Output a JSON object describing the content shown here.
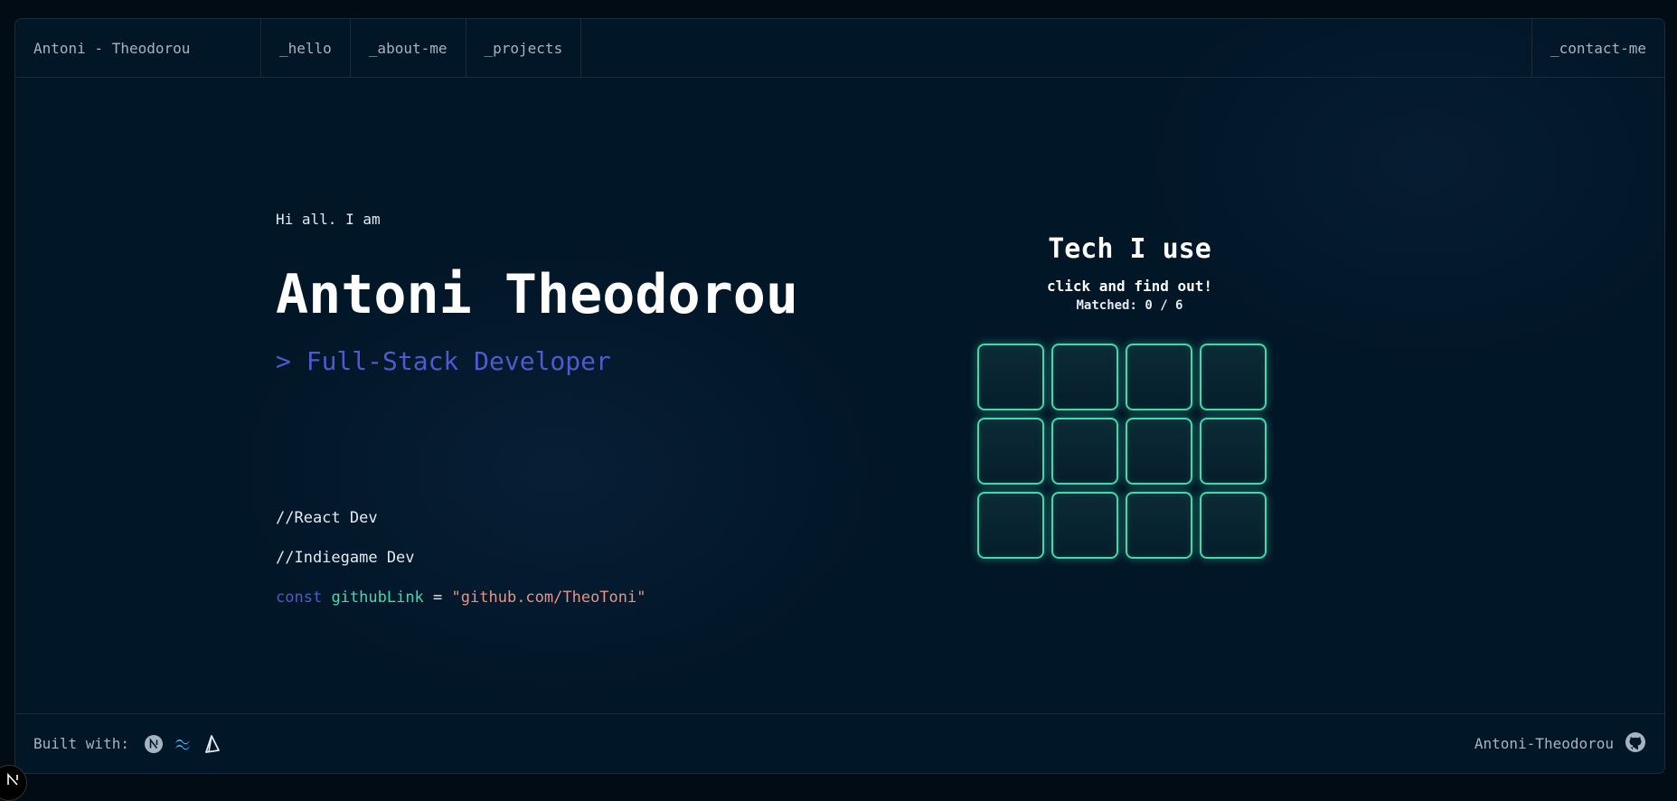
{
  "header": {
    "brand": "Antoni - Theodorou",
    "tabs": [
      {
        "label": "_hello"
      },
      {
        "label": "_about-me"
      },
      {
        "label": "_projects"
      }
    ],
    "contact": "_contact-me"
  },
  "hero": {
    "greeting": "Hi all. I am",
    "name": "Antoni Theodorou",
    "role": "> Full-Stack Developer",
    "comment1": "//React Dev",
    "comment2": "//Indiegame Dev",
    "code": {
      "keyword": "const",
      "variable": "githubLink",
      "equals": "=",
      "value": "\"github.com/TheoToni\""
    }
  },
  "game": {
    "title": "Tech I use",
    "subtitle": "click and find out!",
    "score": "Matched: 0 / 6",
    "card_count": 12
  },
  "footer": {
    "built_with": "Built with:",
    "tech_icons": [
      "nextjs-icon",
      "tailwind-icon",
      "prisma-icon"
    ],
    "github_user": "Antoni-Theodorou",
    "github_icon": "github-icon"
  },
  "colors": {
    "background": "#011627",
    "accent_blue": "#4d5bce",
    "accent_green": "#43d9ad",
    "string_orange": "#e99287",
    "muted_text": "#a7b3c2"
  }
}
